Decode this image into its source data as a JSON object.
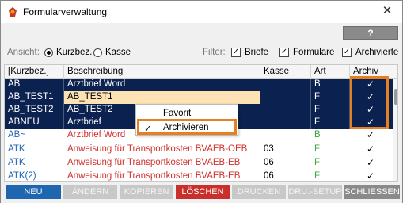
{
  "window": {
    "title": "Formularverwaltung"
  },
  "toolbar": {
    "help_label": "?"
  },
  "filter": {
    "view_label": "Ansicht:",
    "radio_kurzbez": "Kurzbez.",
    "radio_kasse": "Kasse",
    "filter_label": "Filter:",
    "cb_briefe": "Briefe",
    "cb_formulare": "Formulare",
    "cb_archivierte": "Archivierte",
    "check_mark": "✓"
  },
  "table": {
    "headers": [
      "[Kurzbez.]",
      "Beschreibung",
      "Kasse",
      "Art",
      "Archiv"
    ],
    "rows": [
      {
        "kurz": "AB",
        "desc": "Arztbrief Word",
        "kasse": "",
        "art": "B",
        "archiv": "✓"
      },
      {
        "kurz": "AB_TEST1",
        "desc": "AB_TEST1",
        "kasse": "",
        "art": "F",
        "archiv": "✓"
      },
      {
        "kurz": "AB_TEST2",
        "desc": "AB_TEST2",
        "kasse": "",
        "art": "F",
        "archiv": "✓"
      },
      {
        "kurz": "ABNEU",
        "desc": "Arztbrief",
        "kasse": "",
        "art": "F",
        "archiv": "✓"
      },
      {
        "kurz": "AB~",
        "desc": "Arztbrief Word",
        "kasse": "",
        "art": "B",
        "archiv": "✓"
      },
      {
        "kurz": "ATK",
        "desc": "Anweisung für Transportkosten BVAEB-OEB",
        "kasse": "03",
        "art": "F",
        "archiv": "✓"
      },
      {
        "kurz": "ATK",
        "desc": "Anweisung für Transportkosten BVAEB-EB",
        "kasse": "06",
        "art": "F",
        "archiv": "✓"
      },
      {
        "kurz": "ATK(2)",
        "desc": "Anweisung für Transportkosten BVAEB-EB",
        "kasse": "06",
        "art": "F",
        "archiv": "✓"
      }
    ]
  },
  "context_menu": {
    "items": [
      {
        "label": "Favorit",
        "check": ""
      },
      {
        "label": "Archivieren",
        "check": "✓"
      }
    ]
  },
  "buttons": {
    "neu": "NEU",
    "aendern": "ÄNDERN",
    "kopieren": "KOPIEREN",
    "loeschen": "LÖSCHEN",
    "drucken": "DRUCKEN",
    "setup": "DRU.-SETUP",
    "schliessen": "SCHLIESSEN"
  },
  "colors": {
    "selection": "#0b2250",
    "highlight": "#fde3b4",
    "link_blue": "#1f66b0",
    "desc_red": "#d0312d",
    "art_green": "#3aa83a",
    "annotation_orange": "#e67e22"
  }
}
